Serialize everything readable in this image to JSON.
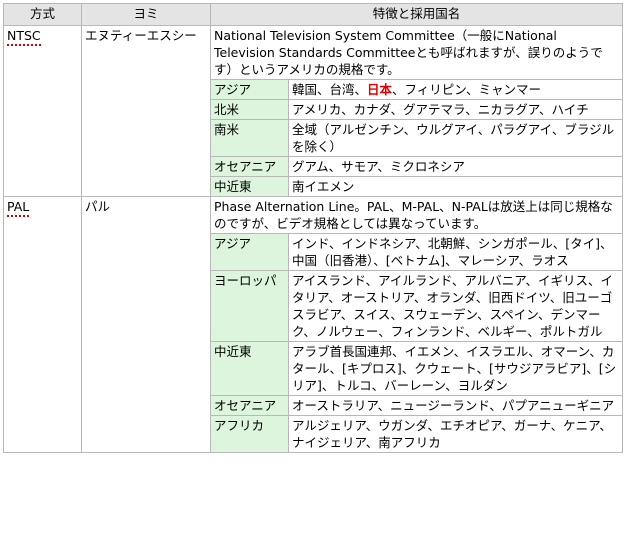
{
  "header": {
    "method": "方式",
    "yomi": "ヨミ",
    "features": "特徴と採用国名"
  },
  "systems": [
    {
      "name": "NTSC",
      "yomi": "エヌティーエスシー",
      "description": "National Television System Committee（一般にNational Television Standards Committeeとも呼ばれますが、誤りのようです）というアメリカの規格です。",
      "regions": [
        {
          "region": "アジア",
          "countries_before": "韓国、台湾、",
          "countries_highlight": "日本",
          "countries_after": "、フィリピン、ミャンマー"
        },
        {
          "region": "北米",
          "countries": "アメリカ、カナダ、グアテマラ、ニカラグア、ハイチ"
        },
        {
          "region": "南米",
          "countries": "全域（アルゼンチン、ウルグアイ、パラグアイ、ブラジルを除く）"
        },
        {
          "region": "オセアニア",
          "countries": "グアム、サモア、ミクロネシア"
        },
        {
          "region": "中近東",
          "countries": "南イエメン"
        }
      ]
    },
    {
      "name": "PAL",
      "yomi": "パル",
      "description": "Phase Alternation Line。PAL、M-PAL、N-PALは放送上は同じ規格なのですが、ビデオ規格としては異なっています。",
      "regions": [
        {
          "region": "アジア",
          "countries": "インド、インドネシア、北朝鮮、シンガポール、[タイ]、中国（旧香港）、[ベトナム]、マレーシア、ラオス"
        },
        {
          "region": "ヨーロッパ",
          "countries": "アイスランド、アイルランド、アルバニア、イギリス、イタリア、オーストリア、オランダ、旧西ドイツ、旧ユーゴスラビア、スイス、スウェーデン、スペイン、デンマーク、ノルウェー、フィンランド、ベルギー、ポルトガル"
        },
        {
          "region": "中近東",
          "countries": "アラブ首長国連邦、イエメン、イスラエル、オマーン、カタール、[キプロス]、クウェート、[サウジアラビア]、[シリア]、トルコ、バーレーン、ヨルダン"
        },
        {
          "region": "オセアニア",
          "countries": "オーストラリア、ニュージーランド、パプアニューギニア"
        },
        {
          "region": "アフリカ",
          "countries": "アルジェリア、ウガンダ、エチオピア、ガーナ、ケニア、ナイジェリア、南アフリカ"
        }
      ]
    }
  ],
  "colors": {
    "header_bg": "#e4e4e4",
    "region_bg": "#dcf5dc",
    "highlight": "#e00000",
    "border": "#b8b8b8"
  }
}
